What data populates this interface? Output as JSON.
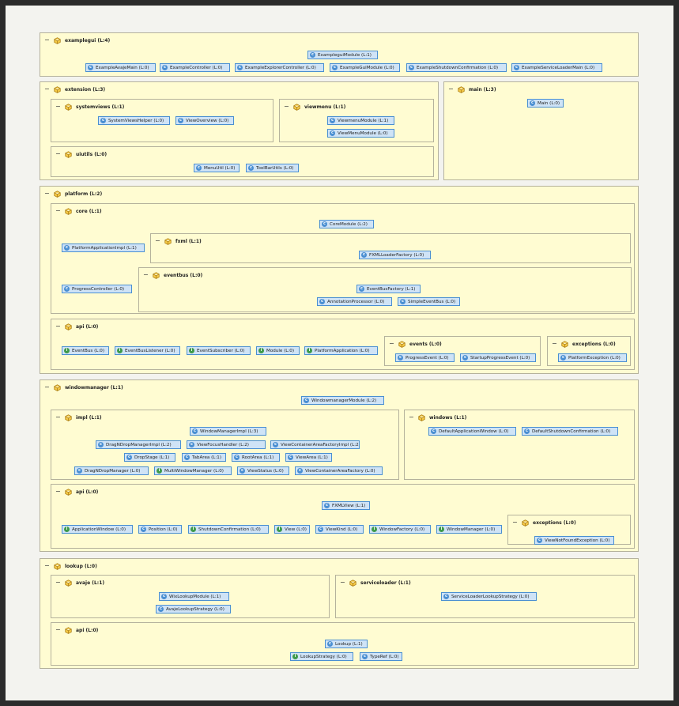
{
  "packages": [
    {
      "id": "examplegui",
      "label": "examplegui (L:4)"
    },
    {
      "id": "extension",
      "label": "extension (L:3)"
    },
    {
      "id": "systemviews",
      "label": "systemviews (L:1)"
    },
    {
      "id": "viewmenu",
      "label": "viewmenu (L:1)"
    },
    {
      "id": "uiutils",
      "label": "uiutils (L:0)"
    },
    {
      "id": "main",
      "label": "main (L:3)"
    },
    {
      "id": "platform",
      "label": "platform (L:2)"
    },
    {
      "id": "core",
      "label": "core (L:1)"
    },
    {
      "id": "fxml",
      "label": "fxml (L:1)"
    },
    {
      "id": "eventbus",
      "label": "eventbus (L:0)"
    },
    {
      "id": "platform_api",
      "label": "api (L:0)"
    },
    {
      "id": "events",
      "label": "events (L:0)"
    },
    {
      "id": "platform_exceptions",
      "label": "exceptions (L:0)"
    },
    {
      "id": "windowmanager",
      "label": "windowmanager (L:1)"
    },
    {
      "id": "impl",
      "label": "impl (L:1)"
    },
    {
      "id": "windows",
      "label": "windows (L:1)"
    },
    {
      "id": "wm_api",
      "label": "api (L:0)"
    },
    {
      "id": "wm_exceptions",
      "label": "exceptions (L:0)"
    },
    {
      "id": "lookup",
      "label": "lookup (L:0)"
    },
    {
      "id": "avaje",
      "label": "avaje (L:1)"
    },
    {
      "id": "serviceloader",
      "label": "serviceloader (L:1)"
    },
    {
      "id": "lookup_api",
      "label": "api (L:0)"
    }
  ],
  "classes": [
    {
      "label": "ExampleguiModule (L:1)",
      "kind": "class",
      "icon": "class-icon"
    },
    {
      "label": "ExampleAvajeMain (L:0)",
      "kind": "class",
      "icon": "class-icon"
    },
    {
      "label": "ExampleController (L:0)",
      "kind": "class",
      "icon": "class-icon"
    },
    {
      "label": "ExampleExplorerController (L:0)",
      "kind": "class",
      "icon": "class-icon"
    },
    {
      "label": "ExampleGuiModule (L:0)",
      "kind": "class",
      "icon": "class-icon"
    },
    {
      "label": "ExampleShutdownConfirmation (L:0)",
      "kind": "class",
      "icon": "class-icon"
    },
    {
      "label": "ExampleServiceLoaderMain (L:0)",
      "kind": "class",
      "icon": "class-icon"
    },
    {
      "label": "SystemViewsHelper (L:0)",
      "kind": "class",
      "icon": "class-icon"
    },
    {
      "label": "ViewOverview (L:0)",
      "kind": "class",
      "icon": "class-icon"
    },
    {
      "label": "ViewmenuModule (L:1)",
      "kind": "class",
      "icon": "class-icon"
    },
    {
      "label": "ViewMenuModule (L:0)",
      "kind": "class",
      "icon": "class-icon"
    },
    {
      "label": "MenuUtil (L:0)",
      "kind": "class",
      "icon": "class-icon"
    },
    {
      "label": "ToolBarUtils (L:0)",
      "kind": "class",
      "icon": "class-icon"
    },
    {
      "label": "Main (L:0)",
      "kind": "class",
      "icon": "class-icon"
    },
    {
      "label": "CoreModule (L:2)",
      "kind": "class",
      "icon": "class-icon"
    },
    {
      "label": "PlatformApplicationImpl (L:1)",
      "kind": "class",
      "icon": "class-icon"
    },
    {
      "label": "FXMLLoaderFactory (L:0)",
      "kind": "class",
      "icon": "class-icon"
    },
    {
      "label": "ProgressController (L:0)",
      "kind": "class",
      "icon": "class-icon"
    },
    {
      "label": "EventBusFactory (L:1)",
      "kind": "class",
      "icon": "class-icon"
    },
    {
      "label": "AnnotationProcessor (L:0)",
      "kind": "class",
      "icon": "class-icon"
    },
    {
      "label": "SimpleEventBus (L:0)",
      "kind": "class",
      "icon": "class-icon"
    },
    {
      "label": "EventBus (L:0)",
      "kind": "interface",
      "icon": "interface-icon"
    },
    {
      "label": "EventBusListener (L:0)",
      "kind": "interface",
      "icon": "interface-icon"
    },
    {
      "label": "EventSubscriber (L:0)",
      "kind": "interface",
      "icon": "interface-icon"
    },
    {
      "label": "Module (L:0)",
      "kind": "interface",
      "icon": "interface-icon"
    },
    {
      "label": "PlatformApplication (L:0)",
      "kind": "interface",
      "icon": "interface-icon"
    },
    {
      "label": "ProgressEvent (L:0)",
      "kind": "class",
      "icon": "class-icon"
    },
    {
      "label": "StartupProgressEvent (L:0)",
      "kind": "class",
      "icon": "class-icon"
    },
    {
      "label": "PlatformException (L:0)",
      "kind": "class",
      "icon": "class-icon"
    },
    {
      "label": "WindowmanagerModule (L:2)",
      "kind": "class",
      "icon": "class-icon"
    },
    {
      "label": "WindowManagerImpl (L:3)",
      "kind": "class",
      "icon": "class-icon"
    },
    {
      "label": "DragNDropManagerImpl (L:2)",
      "kind": "class",
      "icon": "class-icon"
    },
    {
      "label": "ViewFocusHandler (L:2)",
      "kind": "class",
      "icon": "class-icon"
    },
    {
      "label": "ViewContainerAreaFactoryImpl (L:2)",
      "kind": "class",
      "icon": "class-icon"
    },
    {
      "label": "DropStage (L:1)",
      "kind": "class",
      "icon": "class-icon"
    },
    {
      "label": "TabArea (L:1)",
      "kind": "class",
      "icon": "class-icon"
    },
    {
      "label": "RootArea (L:1)",
      "kind": "class",
      "icon": "class-icon"
    },
    {
      "label": "ViewArea (L:1)",
      "kind": "class",
      "icon": "class-icon"
    },
    {
      "label": "DragNDropManager (L:0)",
      "kind": "class",
      "icon": "class-icon"
    },
    {
      "label": "MultiWindowManager (L:0)",
      "kind": "interface",
      "icon": "interface-icon"
    },
    {
      "label": "ViewStatus (L:0)",
      "kind": "class",
      "icon": "class-icon"
    },
    {
      "label": "ViewContainerAreaFactory (L:0)",
      "kind": "class",
      "icon": "class-icon"
    },
    {
      "label": "DefaultApplicationWindow (L:0)",
      "kind": "class",
      "icon": "class-icon"
    },
    {
      "label": "DefaultShutdownConfirmation (L:0)",
      "kind": "class",
      "icon": "class-icon"
    },
    {
      "label": "FXMLView (L:1)",
      "kind": "class",
      "icon": "class-icon"
    },
    {
      "label": "ApplicationWindow (L:0)",
      "kind": "interface",
      "icon": "interface-icon"
    },
    {
      "label": "Position (L:0)",
      "kind": "class",
      "icon": "class-icon"
    },
    {
      "label": "ShutdownConfirmation (L:0)",
      "kind": "interface",
      "icon": "interface-icon"
    },
    {
      "label": "View (L:0)",
      "kind": "interface",
      "icon": "interface-icon"
    },
    {
      "label": "ViewKind (L:0)",
      "kind": "class",
      "icon": "class-icon"
    },
    {
      "label": "WindowFactory (L:0)",
      "kind": "interface",
      "icon": "interface-icon"
    },
    {
      "label": "WindowManager (L:0)",
      "kind": "interface",
      "icon": "interface-icon"
    },
    {
      "label": "ViewNotFoundException (L:0)",
      "kind": "class",
      "icon": "class-icon"
    },
    {
      "label": "WixLookupModule (L:1)",
      "kind": "class",
      "icon": "class-icon"
    },
    {
      "label": "AvajeLookupStrategy (L:0)",
      "kind": "class",
      "icon": "class-icon"
    },
    {
      "label": "ServiceLoaderLookupStrategy (L:0)",
      "kind": "class",
      "icon": "class-icon"
    },
    {
      "label": "Lookup (L:1)",
      "kind": "class",
      "icon": "class-icon"
    },
    {
      "label": "LookupStrategy (L:0)",
      "kind": "interface",
      "icon": "interface-icon"
    },
    {
      "label": "TypeRef (L:0)",
      "kind": "class",
      "icon": "class-icon"
    }
  ],
  "glyphs": {
    "collapse": "−",
    "class": "c",
    "interface": "i"
  },
  "colors": {
    "package_fill": "#fffcd2",
    "class_fill": "#cfe3f6",
    "class_border": "#4a8fd2",
    "interface_icon": "#3e9a4a"
  }
}
